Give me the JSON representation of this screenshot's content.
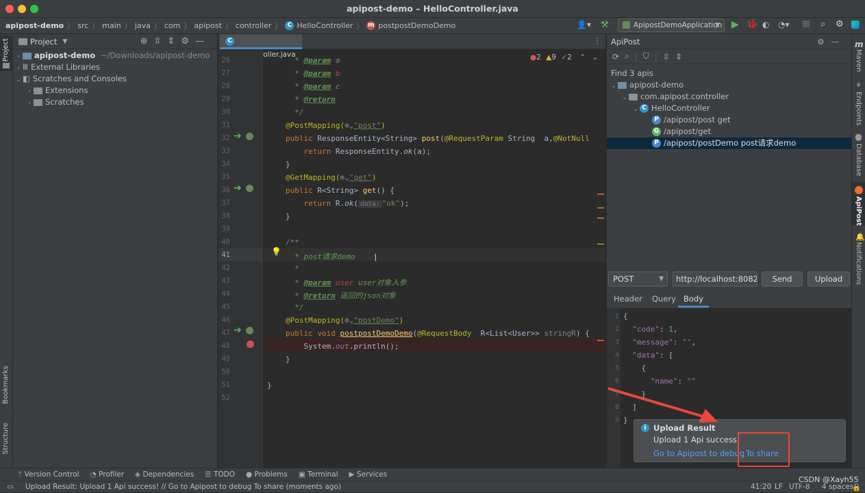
{
  "window": {
    "title": "apipost-demo – HelloController.java"
  },
  "breadcrumb": [
    "apipost-demo",
    "src",
    "main",
    "java",
    "com",
    "apipost",
    "controller",
    "HelloController",
    "postpostDemoDemo"
  ],
  "toolbar": {
    "run_config": "ApipostDemoApplication"
  },
  "left_strip": {
    "project": "Project",
    "bookmarks": "Bookmarks",
    "structure": "Structure"
  },
  "project_panel": {
    "title": "Project",
    "tree": [
      {
        "label": "apipost-demo",
        "path": "~/Downloads/apipost-demo"
      },
      {
        "label": "External Libraries"
      },
      {
        "label": "Scratches and Consoles"
      },
      {
        "label": "Extensions"
      },
      {
        "label": "Scratches"
      }
    ]
  },
  "editor": {
    "tab": "HelloController.java",
    "inspections": {
      "errors": "2",
      "warnings": "9",
      "ok": "2"
    },
    "line_numbers": [
      "26",
      "27",
      "28",
      "29",
      "30",
      "31",
      "32",
      "33",
      "34",
      "35",
      "36",
      "37",
      "38",
      "39",
      "40",
      "41",
      "42",
      "43",
      "44",
      "45",
      "46",
      "47",
      "48",
      "49",
      "50",
      "51",
      "52"
    ],
    "hint_label": "data:",
    "code": {
      "l26_tag": "@param",
      "l26_var": "a",
      "l27_tag": "@param",
      "l27_var": "b",
      "l28_tag": "@param",
      "l28_var": "c",
      "l29_tag": "@return",
      "l30": "*/",
      "l31_ann": "@PostMapping(",
      "l31_str": "\"post\"",
      "l31_end": ")",
      "l32_a": "public ",
      "l32_b": "ResponseEntity<String> ",
      "l32_fn": "post",
      "l32_c": "(",
      "l32_ann": "@RequestParam ",
      "l32_d": "String  a,",
      "l32_ann2": "@NotNull",
      "l33_kw": "return ",
      "l33_b": "ResponseEntity.",
      "l33_it": "ok",
      "l33_c": "(a);",
      "l34": "}",
      "l35_ann": "@GetMapping(",
      "l35_str": "\"get\"",
      "l35_end": ")",
      "l36_kw": "public ",
      "l36_b": "R<String> ",
      "l36_fn": "get",
      "l36_c": "() {",
      "l37_kw": "return ",
      "l37_b": "R.",
      "l37_it": "ok",
      "l37_c": "(",
      "l37_str": "\"ok\"",
      "l37_d": ");",
      "l38": "}",
      "l40": "/**",
      "l41": "* post请求demo",
      "l42": "*",
      "l43_tag": "@param",
      "l43_var": "user",
      "l43_txt": " user对象入参",
      "l44_tag": "@return",
      "l44_txt": " 返回的json对象",
      "l45": "*/",
      "l46_ann": "@PostMapping(",
      "l46_str": "\"postDemo\"",
      "l46_end": ")",
      "l47_kw": "public void ",
      "l47_fn": "postpostDemoDemo",
      "l47_c": "(",
      "l47_ann": "@RequestBody  ",
      "l47_d": "R<List<User>> ",
      "l47_p": "stringR",
      "l47_e": ") {",
      "l48_a": "System.",
      "l48_out": "out",
      "l48_b": ".println();",
      "l49": "}",
      "l51": "}"
    }
  },
  "apipost_panel": {
    "title": "ApiPost",
    "find_label": "Find 3 apis",
    "tree": [
      {
        "label": "apipost-demo"
      },
      {
        "label": "com.apipost.controller"
      },
      {
        "label": "HelloController"
      },
      {
        "label": "/apipost/post  get",
        "badge": "P"
      },
      {
        "label": "/apipost/get",
        "badge": "G"
      },
      {
        "label": "/apipost/postDemo  post请求demo",
        "badge": "P"
      }
    ],
    "method": "POST",
    "url": "http://localhost:8082/",
    "send_label": "Send",
    "upload_label": "Upload",
    "tabs": [
      "Header",
      "Query",
      "Body"
    ],
    "active_tab": "Body",
    "json_line_numbers": [
      "1",
      "2",
      "3",
      "4",
      "5",
      "6",
      "7",
      "8",
      "9"
    ],
    "json": {
      "l1": "{",
      "l2_k": "\"code\"",
      "l2_v": "1",
      "l3_k": "\"message\"",
      "l3_v": "\"\"",
      "l4_k": "\"data\"",
      "l4_v": "[",
      "l5": "{",
      "l6_k": "\"name\"",
      "l6_v": "\"\"",
      "l7": "}",
      "l8": "]",
      "l9": "}"
    }
  },
  "notification": {
    "title": "Upload Result",
    "message": "Upload 1 Api success!",
    "link_debug": "Go to Apipost to debug",
    "link_share": "To share"
  },
  "right_strip": [
    "Maven",
    "Endpoints",
    "Database",
    "ApiPost",
    "Notifications"
  ],
  "bottom_tools": [
    "Version Control",
    "Profiler",
    "Dependencies",
    "TODO",
    "Problems",
    "Terminal",
    "Services"
  ],
  "status": {
    "message": "Upload Result: Upload 1 Api success! // Go to Apipost to debug   To share (moments ago)",
    "position": "41:20",
    "line_sep": "LF",
    "encoding": "UTF-8",
    "indent": "4 spaces",
    "watermark": "CSDN @Xayh55"
  },
  "colors": {
    "accent": "#4a88c7",
    "highlight_box": "#e8483b",
    "arrow": "#e8483b"
  }
}
